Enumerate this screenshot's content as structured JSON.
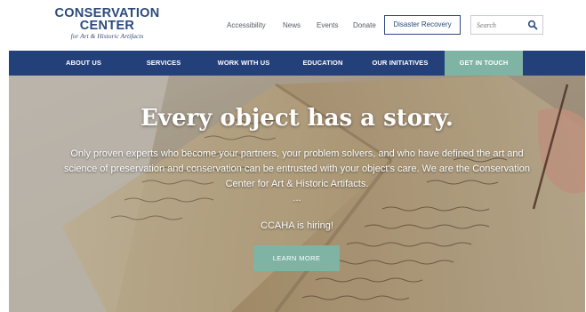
{
  "logo": {
    "line1": "CONSERVATION",
    "line2": "CENTER",
    "line3": "for Art & Historic Artifacts"
  },
  "utility_nav": {
    "accessibility": "Accessibility",
    "news": "News",
    "events": "Events",
    "donate": "Donate",
    "disaster_recovery": "Disaster Recovery"
  },
  "search": {
    "placeholder": "Search",
    "icon": "search-icon"
  },
  "main_nav": {
    "items": [
      {
        "label": "ABOUT US"
      },
      {
        "label": "SERVICES"
      },
      {
        "label": "WORK WITH US"
      },
      {
        "label": "EDUCATION"
      },
      {
        "label": "OUR INITIATIVES"
      },
      {
        "label": "GET IN TOUCH",
        "active": true
      }
    ]
  },
  "hero": {
    "title": "Every object has a story.",
    "body": "Only proven experts who become your partners, your problem solvers, and who have defined the art and science of preservation and conservation can be entrusted with your object's care. We are the Conservation Center for Art & Historic Artifacts.",
    "separator": "...",
    "hiring": "CCAHA is hiring!",
    "cta": "LEARN MORE"
  },
  "colors": {
    "brand_blue": "#23407a",
    "accent_teal": "#7fb3a4",
    "logo_blue": "#2c4a7c"
  }
}
